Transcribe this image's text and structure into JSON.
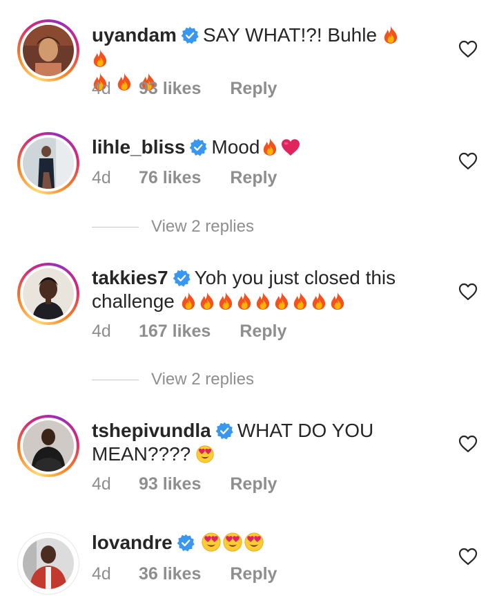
{
  "comments": [
    {
      "username": "uyandam",
      "text": "SAY WHAT!?! Buhle",
      "emojis_line1": [
        "fire",
        "fire"
      ],
      "text2": "",
      "emojis_line2": [
        "fire",
        "fire",
        "fire"
      ],
      "time": "4d",
      "likes": "93 likes",
      "reply": "Reply"
    },
    {
      "username": "lihle_bliss",
      "text": "Mood",
      "emojis_line1": [
        "fire",
        "heart"
      ],
      "time": "4d",
      "likes": "76 likes",
      "reply": "Reply",
      "view_replies": "View 2 replies"
    },
    {
      "username": "takkies7",
      "text": "Yoh you just closed this",
      "text2": "challenge",
      "emojis_line2": [
        "fire",
        "fire",
        "fire",
        "fire",
        "fire",
        "fire",
        "fire",
        "fire",
        "fire"
      ],
      "time": "4d",
      "likes": "167 likes",
      "reply": "Reply",
      "view_replies": "View 2 replies"
    },
    {
      "username": "tshepivundla",
      "text": "WHAT DO YOU",
      "text2": "MEAN????",
      "emojis_line2": [
        "heart-eyes"
      ],
      "time": "4d",
      "likes": "93 likes",
      "reply": "Reply"
    },
    {
      "username": "lovandre",
      "text": "",
      "emojis_line1": [
        "heart-eyes",
        "heart-eyes",
        "heart-eyes"
      ],
      "time": "4d",
      "likes": "36 likes",
      "reply": "Reply"
    }
  ],
  "icons": {
    "verified": "verified-badge-icon",
    "like": "heart-outline-icon"
  },
  "colors": {
    "verified_blue": "#3897f0",
    "muted_text": "#8e8e8e",
    "primary_text": "#262626"
  }
}
